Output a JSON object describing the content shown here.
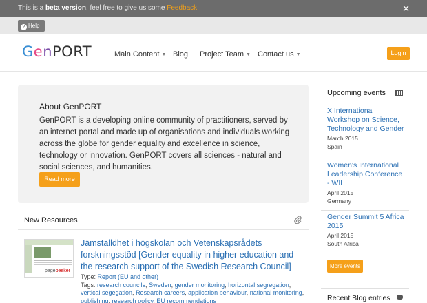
{
  "beta_bar": {
    "prefix": "This is a ",
    "bold": "beta version",
    "middle": ", feel free to give us some ",
    "feedback": "Feedback",
    "close": "✕"
  },
  "help": {
    "label": "Help"
  },
  "header": {
    "logo": {
      "g": "G",
      "e": "e",
      "n": "n",
      "port": "PORT"
    },
    "nav": [
      {
        "label": "Main Content",
        "dropdown": true
      },
      {
        "label": "Blog",
        "dropdown": false
      },
      {
        "label": "Project Team",
        "dropdown": true
      },
      {
        "label": "Contact us",
        "dropdown": true
      }
    ],
    "login": "Login"
  },
  "about": {
    "title": "About GenPORT",
    "text": "GenPORT is a developing online community of practitioners, served by an internet portal and made up of organisations and individuals working across the globe for gender equality and excellence in science, technology or innovation. GenPORT covers all sciences - natural and social sciences, and humanities.",
    "read_more": "Read more"
  },
  "resources": {
    "heading": "New Resources",
    "item": {
      "thumb_label_a": "page",
      "thumb_label_b": "peeker",
      "title": "Jämställdhet i högskolan och Vetenskapsrådets forskningsstöd [Gender equality in higher education and the research support of the Swedish Research Council]",
      "type_label": "Type: ",
      "type_value": "Report (EU and other)",
      "tags_label": "Tags: ",
      "tags": [
        "research councils",
        "Sweden",
        "gender monitoring",
        "horizontal segregation",
        "vertical segegation",
        "Research careers",
        "application behaviour",
        "national monitoring",
        "publishing",
        "research policy",
        "EU recommendations"
      ]
    }
  },
  "sidebar": {
    "events_heading": "Upcoming events",
    "events": [
      {
        "title": "X International Workshop on Science, Technology and Gender",
        "date": "March 2015",
        "place": "Spain"
      },
      {
        "title": "Women's International Leadership Conference - WIL",
        "date": "April 2015",
        "place": "Germany"
      },
      {
        "title": "Gender Summit 5 Africa 2015",
        "date": "April 2015",
        "place": "South Africa"
      }
    ],
    "more_events": "More events",
    "blog_heading": "Recent Blog entries"
  },
  "colors": {
    "accent": "#f5a01a",
    "link": "#2a6fb3",
    "beta_bg": "#6c6c6c"
  }
}
